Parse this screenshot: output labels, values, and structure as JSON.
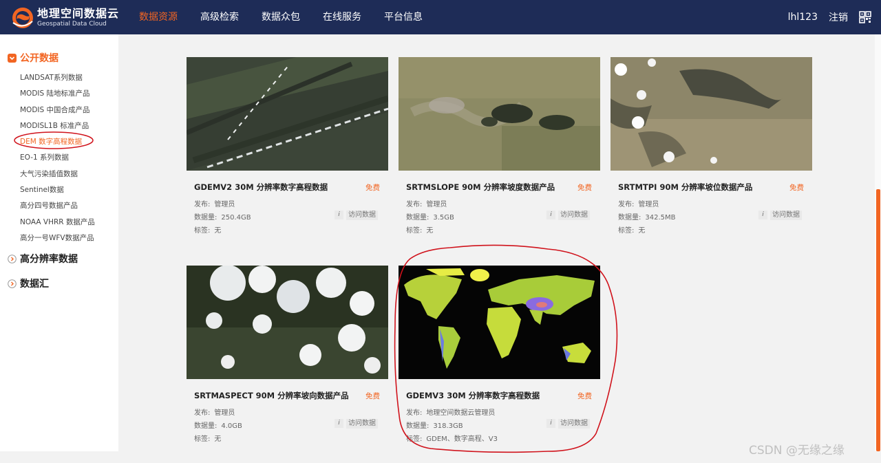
{
  "header": {
    "logo_cn": "地理空间数据云",
    "logo_en": "Geospatial Data Cloud",
    "nav": [
      "数据资源",
      "高级检索",
      "数据众包",
      "在线服务",
      "平台信息"
    ],
    "user": "lhl123",
    "logout": "注销"
  },
  "sidebar": {
    "public": {
      "title": "公开数据",
      "items": [
        "LANDSAT系列数据",
        "MODIS 陆地标准产品",
        "MODIS 中国合成产品",
        "MODISL1B 标准产品",
        "DEM 数字高程数据",
        "EO-1 系列数据",
        "大气污染插值数据",
        "Sentinel数据",
        "高分四号数据产品",
        "NOAA VHRR 数据产品",
        "高分一号WFV数据产品"
      ],
      "active_index": 4
    },
    "hires": {
      "title": "高分辨率数据"
    },
    "hub": {
      "title": "数据汇"
    }
  },
  "labels": {
    "free": "免费",
    "publisher": "发布:",
    "size": "数据量:",
    "tags": "标签:",
    "info": "i",
    "visit": "访问数据"
  },
  "cards": [
    {
      "title": "GDEMV2 30M 分辨率数字高程数据",
      "publisher": "管理员",
      "size": "250.4GB",
      "tags": "无"
    },
    {
      "title": "SRTMSLOPE 90M 分辨率坡度数据产品",
      "publisher": "管理员",
      "size": "3.5GB",
      "tags": "无"
    },
    {
      "title": "SRTMTPI 90M 分辨率坡位数据产品",
      "publisher": "管理员",
      "size": "342.5MB",
      "tags": "无"
    },
    {
      "title": "SRTMASPECT 90M 分辨率坡向数据产品",
      "publisher": "管理员",
      "size": "4.0GB",
      "tags": "无"
    },
    {
      "title": "GDEMV3 30M 分辨率数字高程数据",
      "publisher": "地理空间数据云管理员",
      "size": "318.3GB",
      "tags": "GDEM、数字高程、V3"
    }
  ],
  "watermark": "CSDN @无缘之缘",
  "colors": {
    "nav_bg": "#1e2c57",
    "accent": "#f26522",
    "annotation": "#d0121b"
  }
}
